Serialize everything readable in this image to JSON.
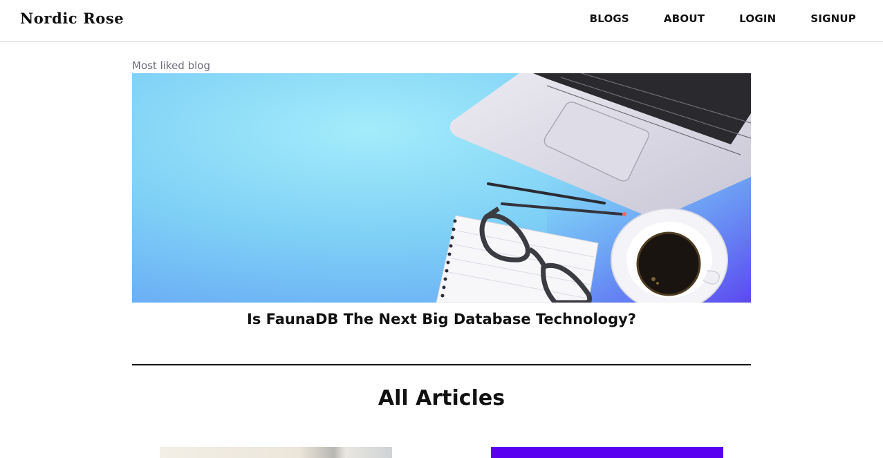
{
  "header": {
    "brand": "Nordic Rose",
    "nav": [
      {
        "label": "BLOGS"
      },
      {
        "label": "ABOUT"
      },
      {
        "label": "LOGIN"
      },
      {
        "label": "SIGNUP"
      }
    ]
  },
  "featured": {
    "label": "Most liked blog",
    "title": "Is FaunaDB The Next Big Database Technology?"
  },
  "articles": {
    "heading": "All Articles"
  },
  "colors": {
    "hero_background": "#8fdcf8",
    "right_card_accent": "#5a00f0"
  }
}
